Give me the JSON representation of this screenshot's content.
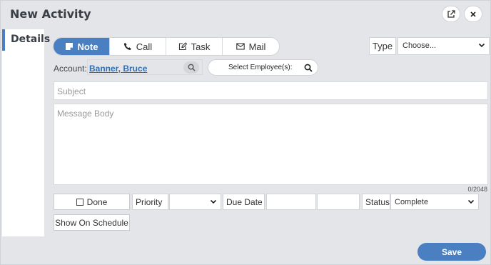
{
  "header": {
    "title": "New Activity"
  },
  "sidebar": {
    "tab_label": "Details"
  },
  "activity_types": [
    {
      "label": "Note",
      "icon": "note-icon"
    },
    {
      "label": "Call",
      "icon": "phone-icon"
    },
    {
      "label": "Task",
      "icon": "edit-icon"
    },
    {
      "label": "Mail",
      "icon": "mail-icon"
    }
  ],
  "type_field": {
    "label": "Type",
    "value": "Choose..."
  },
  "account": {
    "label": "Account:",
    "value": "Banner, Bruce"
  },
  "employee": {
    "label": "Select Employee(s):"
  },
  "subject": {
    "placeholder": "Subject"
  },
  "message": {
    "placeholder": "Message Body",
    "counter": "0/2048"
  },
  "done": {
    "label": "Done"
  },
  "priority": {
    "label": "Priority",
    "value": ""
  },
  "due_date": {
    "label": "Due Date",
    "date": "",
    "time": ""
  },
  "status": {
    "label": "Status",
    "value": "Complete"
  },
  "schedule": {
    "label": "Show On Schedule"
  },
  "footer": {
    "save_label": "Save"
  },
  "colors": {
    "accent": "#4a7fc1",
    "link": "#2f6fb5",
    "background": "#e3e5e8"
  }
}
